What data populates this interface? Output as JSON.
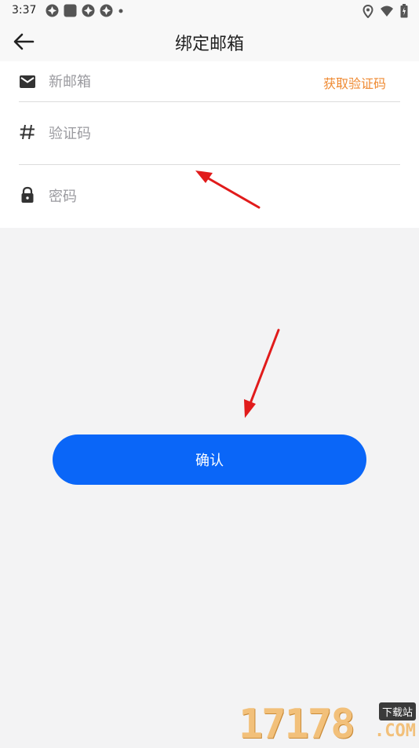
{
  "status_bar": {
    "time": "3:37",
    "left_icons": [
      "notification-icon",
      "notification-icon",
      "notification-icon",
      "notification-icon",
      "dot-icon"
    ],
    "right_icons": [
      "location-icon",
      "wifi-icon",
      "battery-icon"
    ]
  },
  "app_bar": {
    "title": "绑定邮箱",
    "back_icon": "back-arrow-icon"
  },
  "form": {
    "email": {
      "placeholder": "新邮箱",
      "value": "",
      "icon": "mail-icon",
      "get_code_label": "获取验证码"
    },
    "code": {
      "placeholder": "验证码",
      "value": "",
      "icon": "hash-icon"
    },
    "password": {
      "placeholder": "密码",
      "value": "",
      "icon": "lock-icon"
    }
  },
  "confirm": {
    "label": "确认"
  },
  "watermark": {
    "digits": "17178",
    "tag": "下载站",
    "domain": ".COM"
  },
  "colors": {
    "accent": "#0a66f8",
    "link_orange": "#ef8a32",
    "annotation_red": "#e11b1b"
  }
}
